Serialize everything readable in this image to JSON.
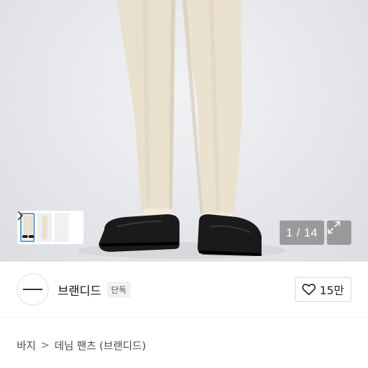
{
  "gallery": {
    "counter": "1 / 14"
  },
  "shop": {
    "name": "브랜디드",
    "badge": "단독",
    "likes": "15만"
  },
  "breadcrumb": {
    "items": [
      "바지",
      "데님 팬츠 (브랜디드)"
    ],
    "separator": ">"
  },
  "icons": {
    "thumb_next": "chevron-right-icon",
    "expand": "expand-arrows-icon",
    "like": "heart-outline-icon"
  }
}
